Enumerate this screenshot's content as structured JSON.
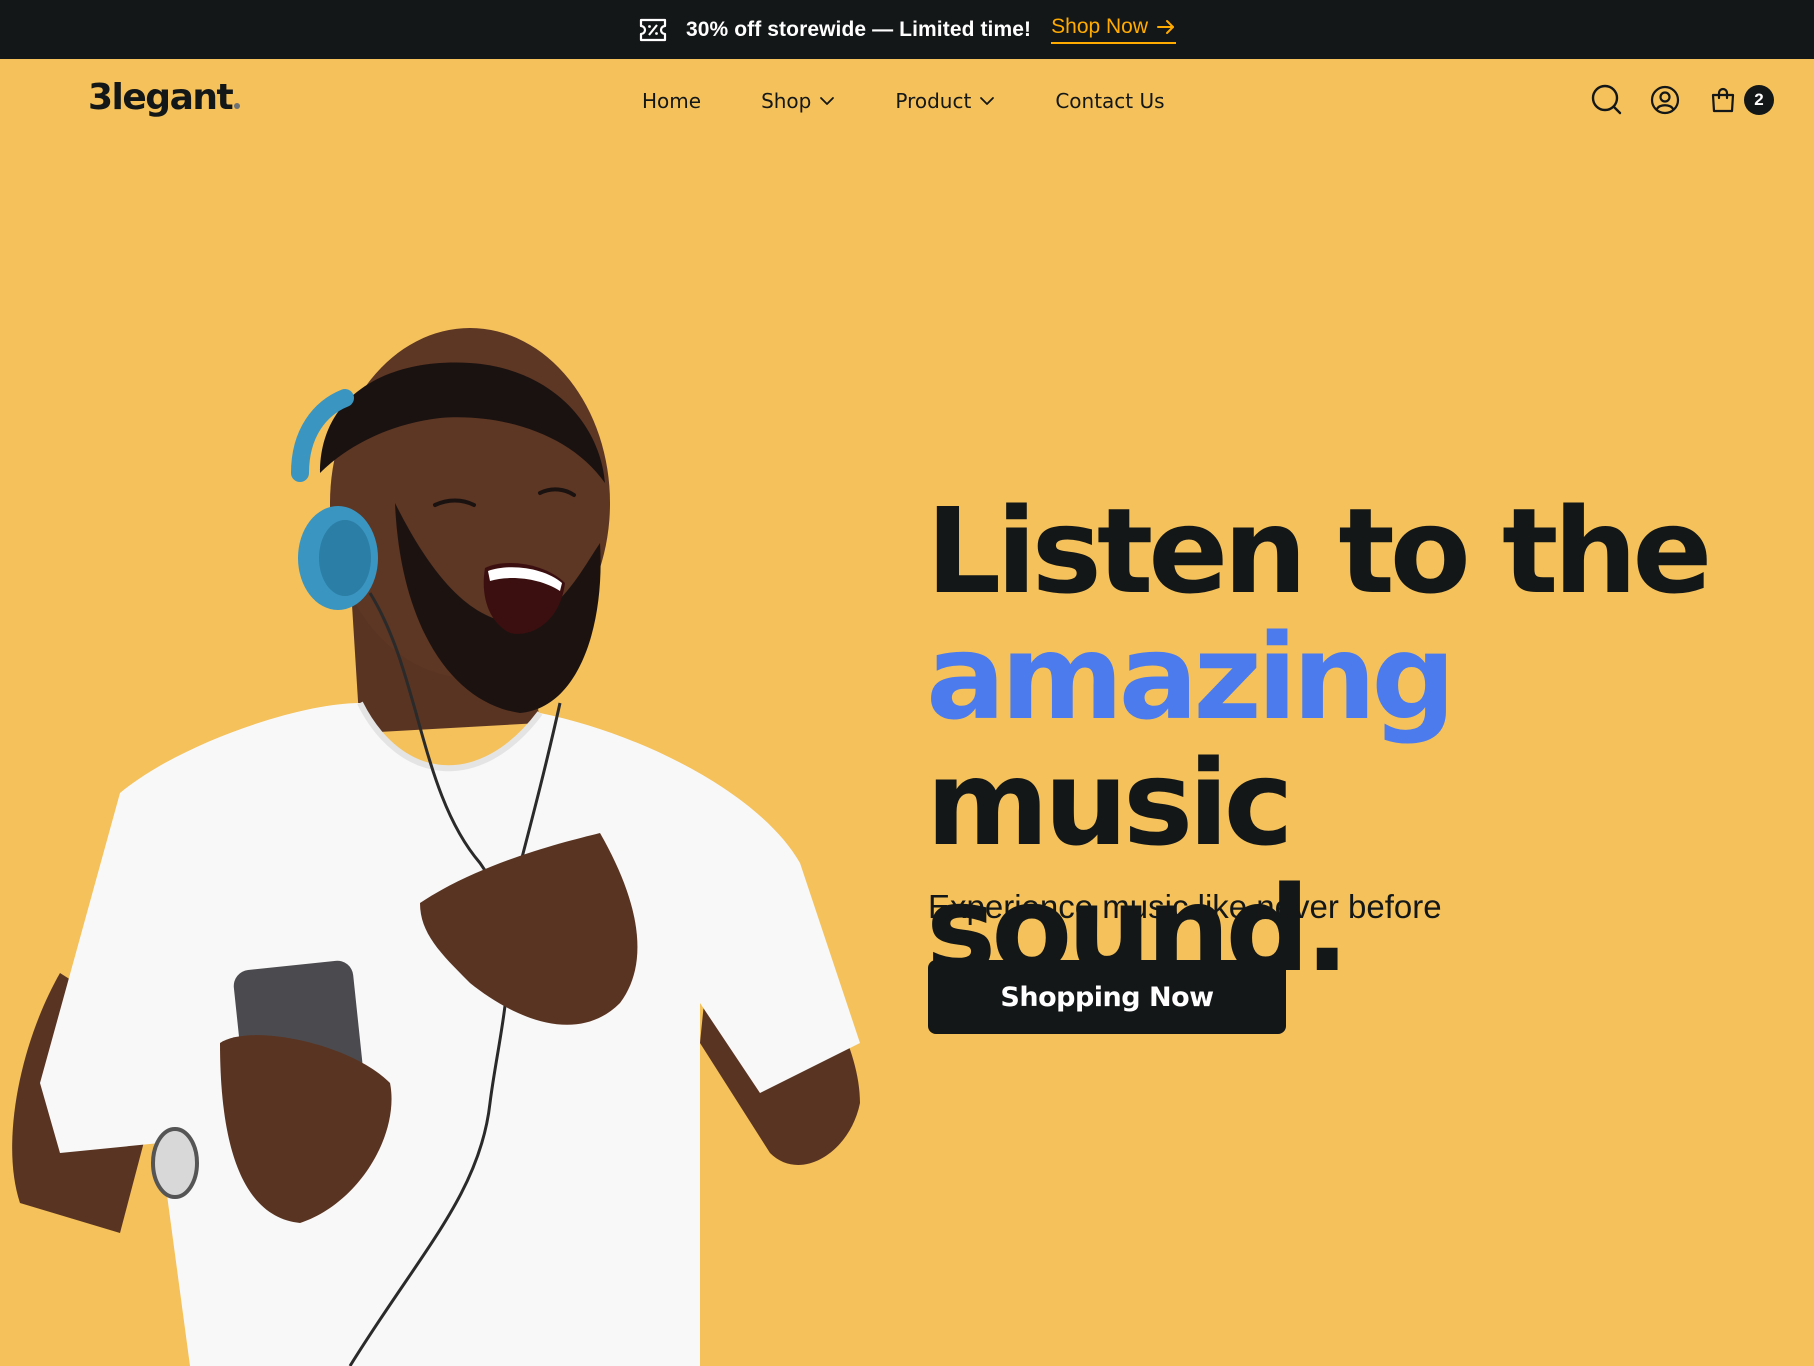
{
  "promo_bar": {
    "icon": "ticket-percent-icon",
    "text": "30% off storewide — Limited time!",
    "link_label": "Shop Now",
    "link_icon": "arrow-right-icon",
    "link_color": "#ffab00"
  },
  "header": {
    "logo_text": "3legant",
    "nav": [
      {
        "label": "Home",
        "has_dropdown": false
      },
      {
        "label": "Shop",
        "has_dropdown": true
      },
      {
        "label": "Product",
        "has_dropdown": true
      },
      {
        "label": "Contact Us",
        "has_dropdown": false
      }
    ],
    "icons": [
      "search-icon",
      "user-icon",
      "shopping-bag-icon"
    ],
    "cart_count": "2"
  },
  "hero": {
    "headline_line1": "Listen to the",
    "headline_accent": "amazing",
    "headline_rest": "music",
    "headline_line3": "sound.",
    "subtitle": "Experience music like never before",
    "cta_label": "Shopping Now",
    "image": "man-with-headphones-photo",
    "background_color": "#f4c15b",
    "accent_color": "#4b7bec"
  }
}
